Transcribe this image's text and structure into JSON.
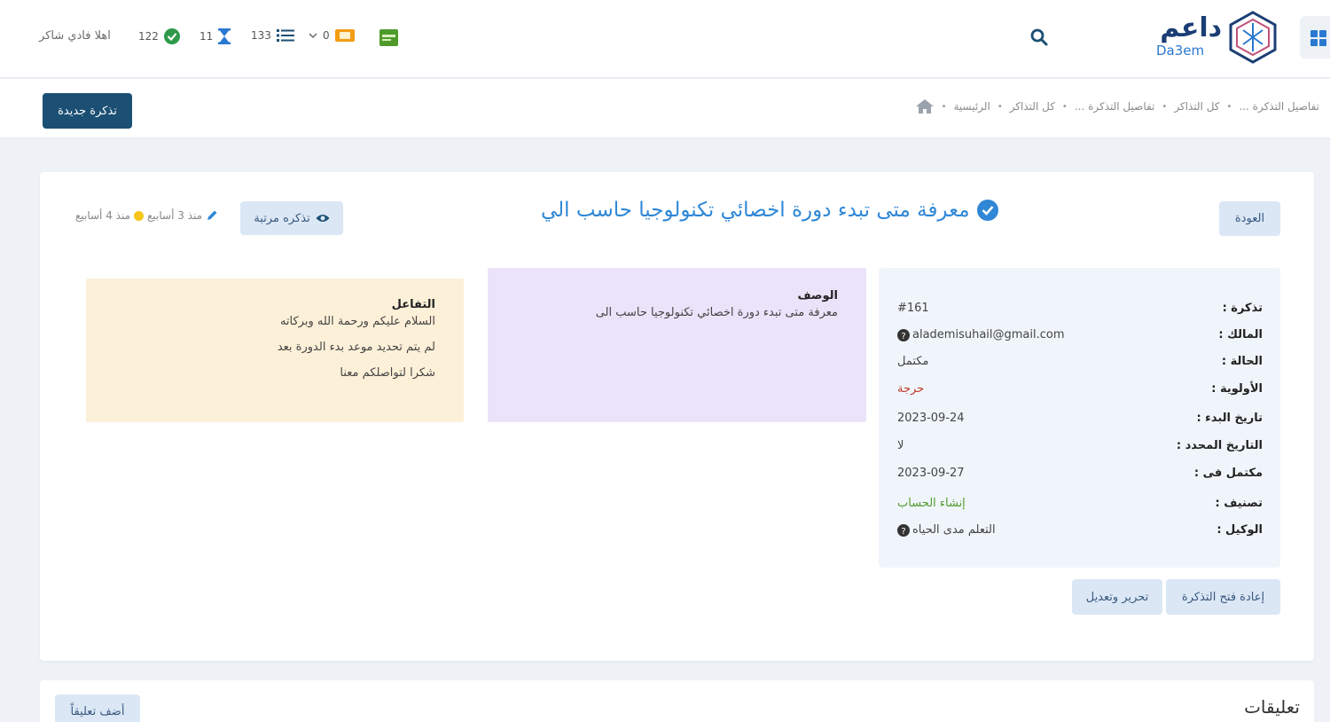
{
  "header": {
    "logo_text": "داعم",
    "logo_sub": "Da3em",
    "greeting": "اهلا فادي شاكر",
    "completed_count": "122",
    "pending_count": "11",
    "list_count": "133",
    "tickets_count": "0"
  },
  "breadcrumb": {
    "items": [
      "الرئيسية",
      "كل التذاكر",
      "تفاصيل التذكرة ...",
      "كل التذاكر",
      "تفاصيل التذكرة ..."
    ],
    "new_ticket_label": "تذكرة جديدة"
  },
  "ticket": {
    "back_label": "العودة",
    "title": "معرفة متى تبدء دورة اخصائي تكنولوجيا حاسب الي",
    "sorted_label": "تذكره مرتبة",
    "meta_edited": "منذ 3 أسابيع",
    "meta_created": "منذ 4 أسابيع",
    "details": [
      {
        "label": "تذكرة :",
        "value": "#161"
      },
      {
        "label": "المالك :",
        "value": "alademisuhail@gmail.com"
      },
      {
        "label": "الحالة :",
        "value": "مكتمل"
      },
      {
        "label": "الأولوية :",
        "value": "حرجة"
      },
      {
        "label": "تاريخ البدء :",
        "value": "2023-09-24"
      },
      {
        "label": "التاريخ المحدد :",
        "value": "لا"
      },
      {
        "label": "مكتمل فى :",
        "value": "2023-09-27"
      },
      {
        "label": "تصنيف :",
        "value": "إنشاء الحساب"
      },
      {
        "label": "الوكيل :",
        "value": "التعلم مدى الحياه"
      }
    ],
    "reopen_label": "إعادة فتح التذكرة",
    "edit_label": "تحرير وتعديل",
    "description_head": "الوصف",
    "description_text": "معرفة متى تبدء دورة اخصائي تكنولوجيا حاسب الى",
    "interaction_head": "التفاعل",
    "interaction_lines": [
      "السلام عليكم ورحمة الله وبركاته",
      "لم يتم تحديد موعد بدء الدورة بعد",
      "شكرا لتواصلكم معنا"
    ]
  },
  "comments": {
    "title": "تعليقات",
    "add_label": "أضف تعليقاً"
  },
  "colors": {
    "primary": "#1b4f73",
    "accent": "#2f87d6",
    "desc_bg": "#ebe3fa",
    "interaction_bg": "#fdf0d8",
    "details_bg": "#f0f5fb"
  }
}
